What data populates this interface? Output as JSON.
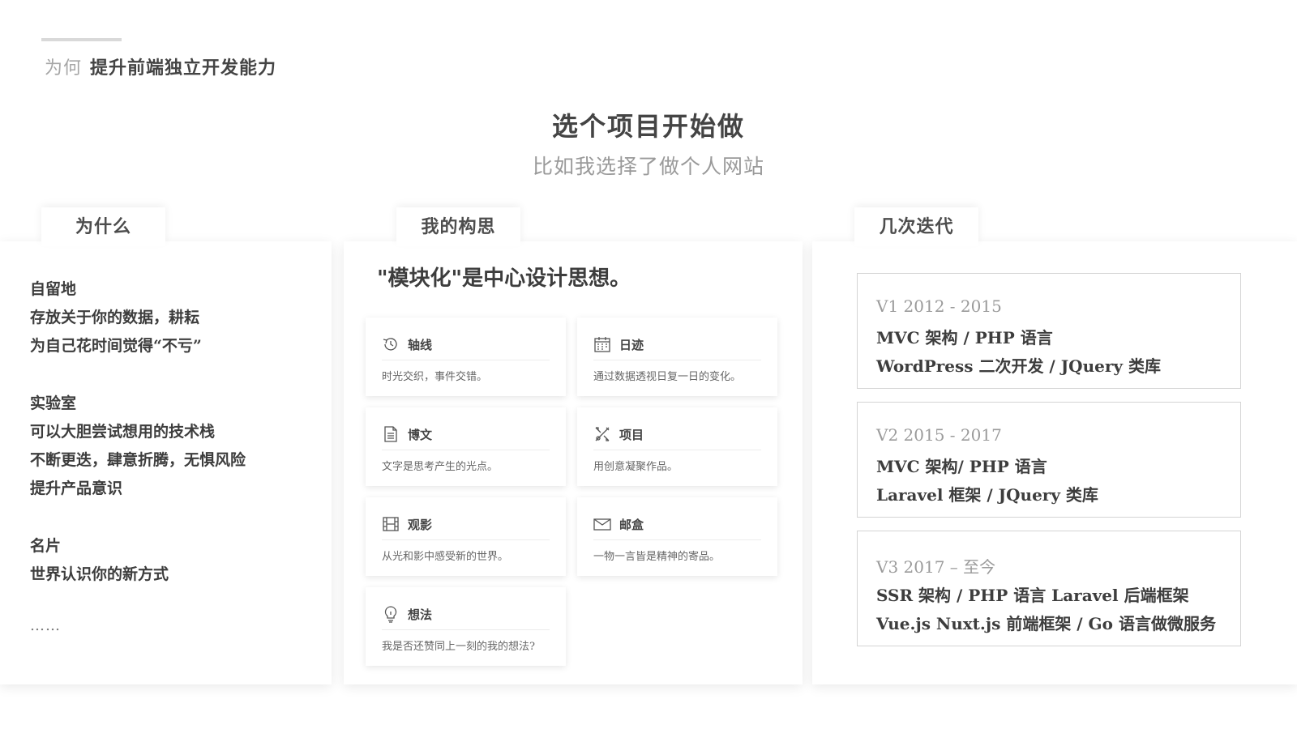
{
  "header": {
    "breadcrumb_prefix": "为何",
    "breadcrumb_title": "提升前端独立开发能力"
  },
  "hero": {
    "title": "选个项目开始做",
    "subtitle": "比如我选择了做个人网站"
  },
  "why_panel": {
    "tab": "为什么",
    "groups": [
      {
        "lines": [
          "自留地",
          "存放关于你的数据，耕耘",
          "为自己花时间觉得“不亏”"
        ]
      },
      {
        "lines": [
          "实验室",
          "可以大胆尝试想用的技术栈",
          "不断更迭，肆意折腾，无惧风险",
          "提升产品意识"
        ]
      },
      {
        "lines": [
          "名片",
          "世界认识你的新方式"
        ]
      }
    ],
    "ellipsis": "……"
  },
  "concept_panel": {
    "tab": "我的构思",
    "heading": "\"模块化\"是中心设计思想。",
    "modules": [
      {
        "icon": "timeline-icon",
        "title": "轴线",
        "desc": "时光交织，事件交错。"
      },
      {
        "icon": "calendar-icon",
        "title": "日迹",
        "desc": "通过数据透视日复一日的变化。"
      },
      {
        "icon": "document-icon",
        "title": "博文",
        "desc": "文字是思考产生的光点。"
      },
      {
        "icon": "tools-icon",
        "title": "项目",
        "desc": "用创意凝聚作品。"
      },
      {
        "icon": "film-icon",
        "title": "观影",
        "desc": "从光和影中感受新的世界。"
      },
      {
        "icon": "mail-icon",
        "title": "邮盒",
        "desc": "一物一言皆是精神的寄品。"
      },
      {
        "icon": "lightbulb-icon",
        "title": "想法",
        "desc": "我是否还赞同上一刻的我的想法?"
      }
    ]
  },
  "iterations_panel": {
    "tab": "几次迭代",
    "versions": [
      {
        "head": "V1 2012 - 2015",
        "line1": "MVC 架构 / PHP  语言",
        "line2": "WordPress 二次开发 / JQuery 类库"
      },
      {
        "head": "V2 2015 - 2017",
        "line1": "MVC 架构/ PHP 语言",
        "line2": "Laravel 框架 / JQuery 类库"
      },
      {
        "head": "V3 2017 – 至今",
        "line1": "SSR 架构 / PHP 语言 Laravel 后端框架",
        "line2": "Vue.js Nuxt.js 前端框架 / Go 语言做微服务"
      }
    ]
  }
}
